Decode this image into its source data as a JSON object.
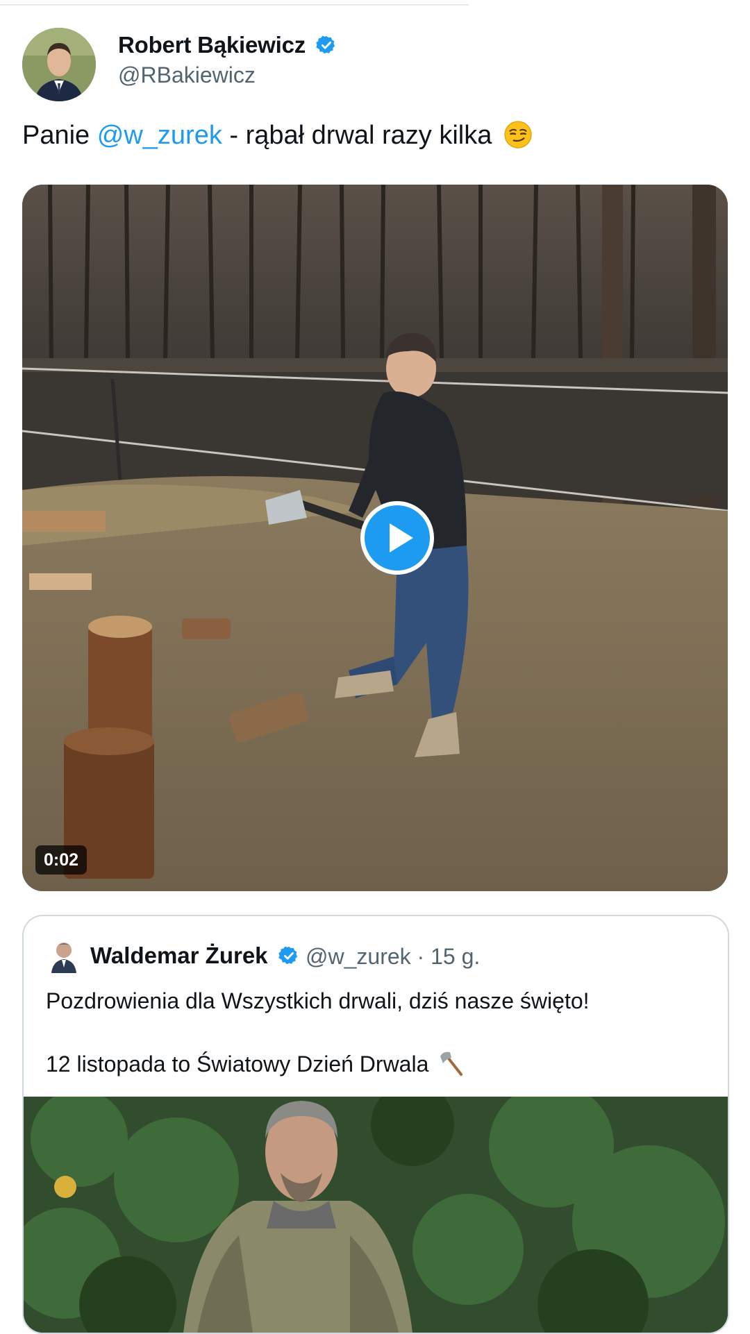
{
  "post": {
    "author_name": "Robert Bąkiewicz",
    "author_handle": "@RBakiewicz",
    "text_prefix": "Panie ",
    "mention": "@w_zurek",
    "text_suffix": " - rąbał drwal razy kilka",
    "emoji": "smirking-face",
    "video": {
      "timestamp": "0:02"
    }
  },
  "quoted_post": {
    "author_name": "Waldemar Żurek",
    "author_handle": "@w_zurek",
    "time_separator": "·",
    "time_ago": "15 g.",
    "line1": "Pozdrowienia dla Wszystkich drwali, dziś nasze święto!",
    "line2": "12 listopada to Światowy Dzień Drwala",
    "emoji": "axe"
  },
  "colors": {
    "accent": "#1d9bf0",
    "text": "#0f1419",
    "secondary_text": "#536471",
    "border": "#cfd9de"
  }
}
